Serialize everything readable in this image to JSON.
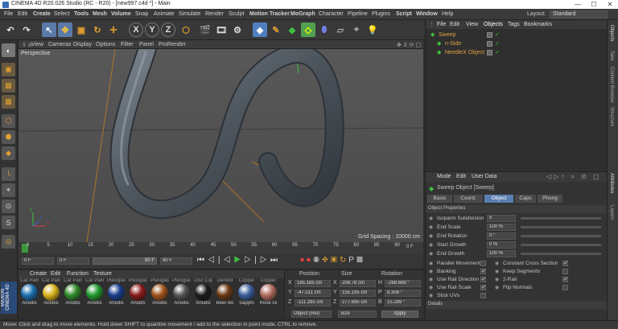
{
  "window": {
    "title": "CINEMA 4D R20.026 Studio (RC - R20) - [new997.c4d *] - Main",
    "minimize": "—",
    "maximize": "☐",
    "close": "✕"
  },
  "menubar": {
    "items": [
      "File",
      "Edit",
      "Create",
      "Select",
      "Tools",
      "Mesh",
      "Volume",
      "Snap",
      "Animate",
      "Simulate",
      "Render",
      "Sculpt",
      "Motion Tracker",
      "MoGraph",
      "Character",
      "Pipeline",
      "Plugins",
      "Script",
      "Window",
      "Help"
    ],
    "layout_label": "Layout:",
    "layout_value": "Standard"
  },
  "toolbar": {
    "axis_x": "X",
    "axis_y": "Y",
    "axis_z": "Z"
  },
  "viewport": {
    "menu": [
      "View",
      "Cameras",
      "Display",
      "Options",
      "Filter",
      "Panel",
      "ProRender"
    ],
    "camera_label": "Perspective",
    "grid_spacing": "Grid Spacing : 10000 cm",
    "axis_y_label": "Y",
    "axis_x_label": "X",
    "axis_z_label": "Z"
  },
  "timeline": {
    "ticks": [
      "0",
      "5",
      "10",
      "15",
      "20",
      "25",
      "30",
      "35",
      "40",
      "45",
      "50",
      "55",
      "60",
      "65",
      "70",
      "75",
      "80",
      "85",
      "90"
    ],
    "frame_end_label": "0 F"
  },
  "transport": {
    "current_frame": "0 F",
    "start_frame": "0 F",
    "range_end": "90 F",
    "end_frame": "90 F"
  },
  "materials": {
    "menu": [
      "Create",
      "Edit",
      "Function",
      "Texture"
    ],
    "top_labels": [
      "Car Pain",
      "Car Pain",
      "Car Pain",
      "Car Pain",
      "Plexiglas",
      "Plexiglas",
      "Plexiglas",
      "Plexiglas",
      "Disc Cop",
      "Dented",
      "Copper",
      "Copper"
    ],
    "items": [
      {
        "name": "Anodis",
        "color": "#1b6fb0"
      },
      {
        "name": "Anodis",
        "color": "#d9b21a"
      },
      {
        "name": "Anodis",
        "color": "#2f8a2a"
      },
      {
        "name": "Anodis",
        "color": "#1f9a2c"
      },
      {
        "name": "Anodis",
        "color": "#1a3d8f"
      },
      {
        "name": "Anodis",
        "color": "#8a1b1b"
      },
      {
        "name": "Anodis",
        "color": "#a0541a"
      },
      {
        "name": "Anodis",
        "color": "#555555"
      },
      {
        "name": "Anodis",
        "color": "#1b1b1b"
      },
      {
        "name": "Beer Bo",
        "color": "#6b3a15"
      },
      {
        "name": "Sapphi",
        "color": "#3a5e9a"
      },
      {
        "name": "Rose Gi",
        "color": "#b06a5e"
      }
    ]
  },
  "coords": {
    "headers": [
      "Position",
      "Size",
      "Rotation"
    ],
    "rows": [
      {
        "axis": "X",
        "pos": "165.165 cm",
        "size_axis": "X",
        "size": "208.78 cm",
        "rot_axis": "H",
        "rot": "-268.689 °"
      },
      {
        "axis": "Y",
        "pos": "-47.511 cm",
        "size_axis": "Y",
        "size": "155.195 cm",
        "rot_axis": "P",
        "rot": "8.306 °"
      },
      {
        "axis": "Z",
        "pos": "-111.285 cm",
        "size_axis": "Z",
        "size": "277.695 cm",
        "rot_axis": "B",
        "rot": "15.289 °"
      }
    ],
    "mode_select": "Object (Rel)",
    "size_select": "Size",
    "apply": "Apply"
  },
  "objects": {
    "tabs": [
      "File",
      "Edit",
      "View",
      "Objects",
      "Tags",
      "Bookmarks"
    ],
    "items": [
      {
        "name": "Sweep",
        "indent": 0,
        "color": "#e0a040"
      },
      {
        "name": "n-Side",
        "indent": 1,
        "color": "#e0a040"
      },
      {
        "name": "NeedleX Object",
        "indent": 1,
        "color": "#e0a040"
      }
    ]
  },
  "attributes": {
    "menu": [
      "Mode",
      "Edit",
      "User Data"
    ],
    "object_name": "Sweep Object [Sweep]",
    "tabs": [
      "Basic",
      "Coord.",
      "Object",
      "Caps",
      "Phong"
    ],
    "active_tab": "Object",
    "section": "Object Properties",
    "properties": [
      {
        "label": "Isoparm Subdivision",
        "value": "5"
      },
      {
        "label": "End Scale",
        "value": "100 %"
      },
      {
        "label": "End Rotation",
        "value": "0 °"
      },
      {
        "label": "Start Growth",
        "value": "0 %"
      },
      {
        "label": "End Growth",
        "value": "100 %"
      }
    ],
    "checks_left": [
      {
        "label": "Parallel Movement",
        "checked": false
      },
      {
        "label": "Banking",
        "checked": true
      },
      {
        "label": "Use Rail Direction",
        "checked": true
      },
      {
        "label": "Use Rail Scale",
        "checked": true
      },
      {
        "label": "Stick UVs",
        "checked": false
      }
    ],
    "checks_right": [
      {
        "label": "Constant Cross Section",
        "checked": true
      },
      {
        "label": "Keep Segments",
        "checked": false
      },
      {
        "label": "2-Rail",
        "checked": true
      },
      {
        "label": "Flip Normals",
        "checked": false
      }
    ],
    "details": "Details"
  },
  "right_tabs": [
    "Objects",
    "Take",
    "Content Browser",
    "Structure",
    "Attributes",
    "Layers"
  ],
  "statusbar": {
    "text": "Move: Click and drag to move elements. Hold down SHIFT to quantize movement / add to the selection in point mode, CTRL to remove."
  },
  "side_logo": "MAXON CINEMA 4D"
}
